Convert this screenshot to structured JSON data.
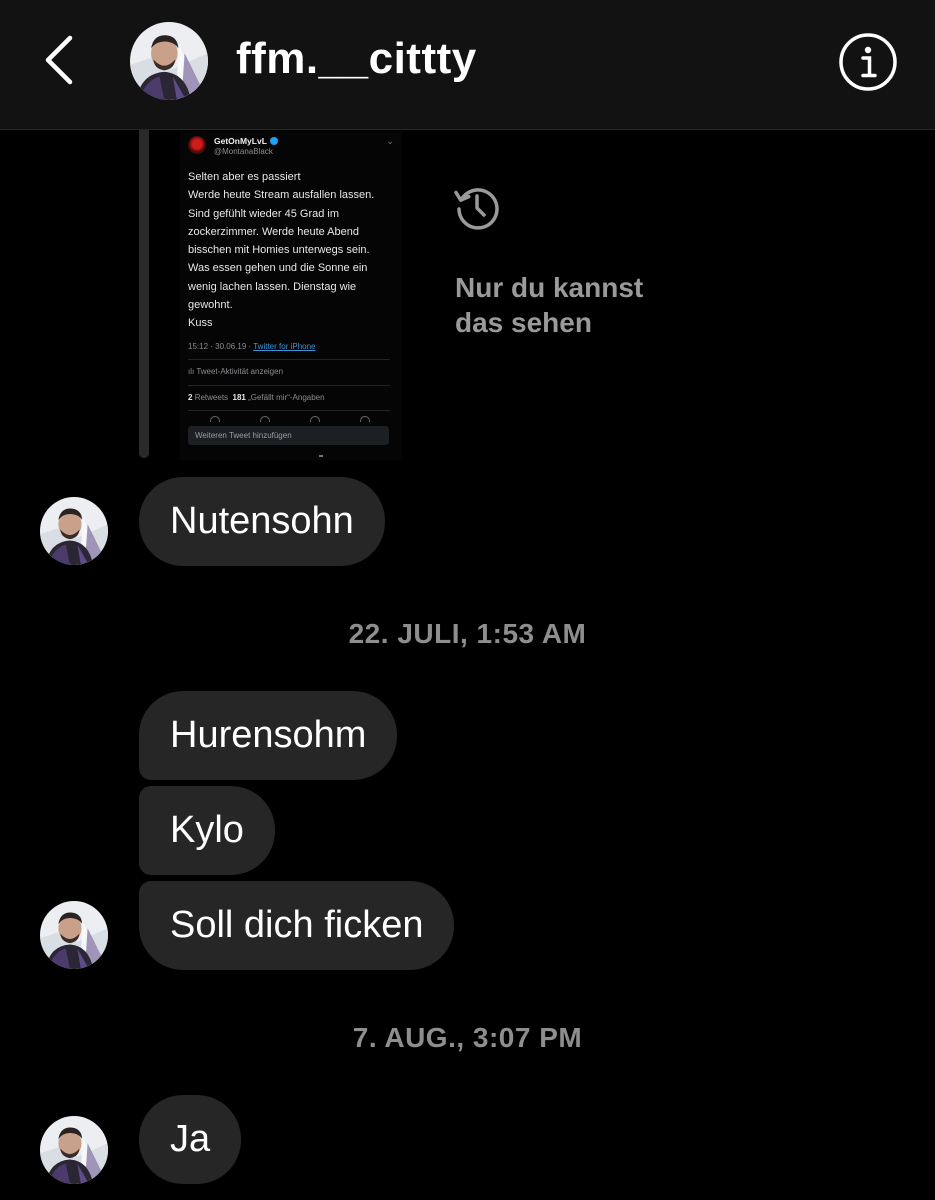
{
  "header": {
    "title": "ffm.__cittty",
    "back_icon": "chevron-left-icon",
    "info_icon": "info-circle-icon"
  },
  "shared_tweet": {
    "display_name": "GetOnMyLvL",
    "handle": "@MontanaBlack",
    "text_lines": [
      "Selten aber es passiert",
      "Werde heute Stream ausfallen lassen.",
      "Sind gefühlt wieder 45 Grad im",
      "zockerzimmer. Werde heute Abend",
      "bisschen mit Homies unterwegs sein.",
      "Was essen gehen und die Sonne ein",
      "wenig lachen lassen. Dienstag wie",
      "gewohnt.",
      "Kuss"
    ],
    "time": "15:12 · 30.06.19 · ",
    "source": "Twitter for iPhone",
    "activity": "Tweet-Aktivität anzeigen",
    "retweets_count": "2",
    "retweets_label": "Retweets",
    "likes_count": "181",
    "likes_label": "„Gefällt mir“-Angaben",
    "reply_placeholder": "Weiteren Tweet hinzufügen"
  },
  "notice": {
    "icon": "history-icon",
    "text": "Nur du kannst\ndas sehen"
  },
  "messages": [
    {
      "text": "Nutensohn"
    },
    {
      "timestamp": "22. JULI, 1:53 AM"
    },
    {
      "text": "Hurensohm"
    },
    {
      "text": "Kylo"
    },
    {
      "text": "Soll dich ficken"
    },
    {
      "timestamp": "7. AUG., 3:07 PM"
    },
    {
      "text": "Ja"
    }
  ],
  "colors": {
    "background": "#000000",
    "header_background": "#121212",
    "bubble_background": "#262626",
    "timestamp_text": "#8e8e8e",
    "notice_text": "#9a9a9a",
    "link": "#3b94d9"
  }
}
